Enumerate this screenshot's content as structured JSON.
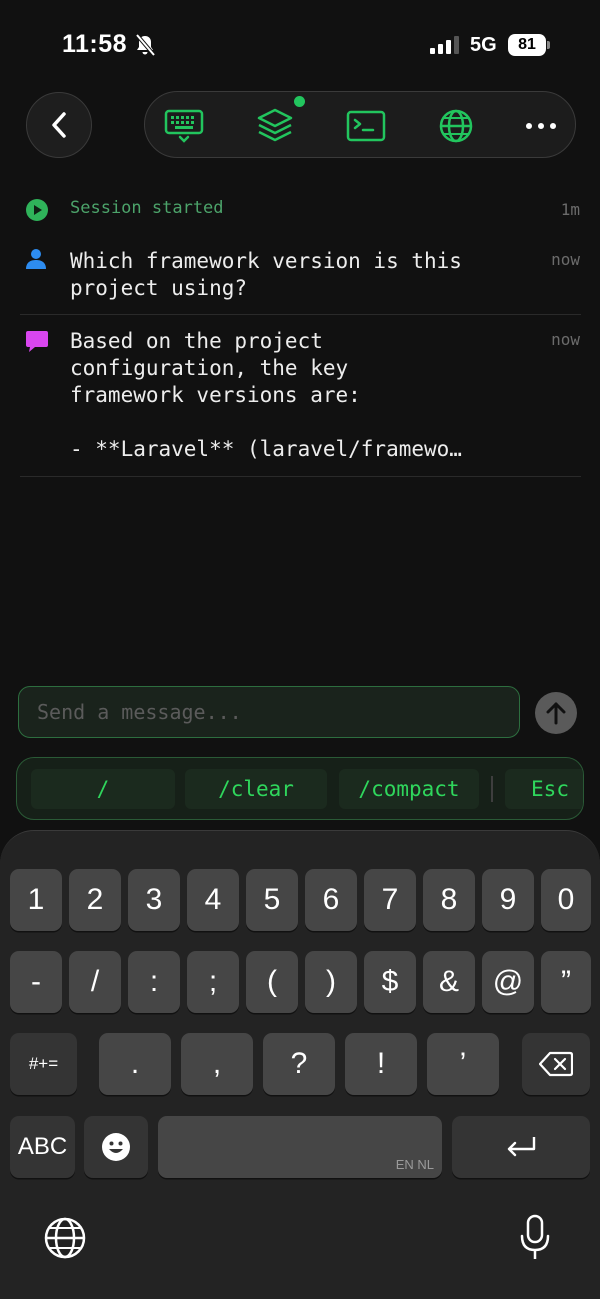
{
  "status_bar": {
    "time": "11:58",
    "network": "5G",
    "battery": "81"
  },
  "toolbar": {
    "icons": [
      "keyboard-icon",
      "layers-icon",
      "terminal-icon",
      "globe-icon",
      "more-icon"
    ],
    "accent": "#22c55e"
  },
  "session": {
    "text": "Session started",
    "time": "1m"
  },
  "messages": [
    {
      "role": "user",
      "icon": "user-icon",
      "text": "Which framework version is this\nproject using?",
      "time": "now"
    },
    {
      "role": "assistant",
      "icon": "chat-bubble-icon",
      "text": "Based on the project\nconfiguration, the key\nframework versions are:\n\n- **Laravel** (laravel/framewo…",
      "time": "now"
    }
  ],
  "composer": {
    "placeholder": "Send a message..."
  },
  "quick_commands": [
    "/",
    "/clear",
    "/compact",
    "Esc"
  ],
  "keyboard": {
    "row1": [
      "1",
      "2",
      "3",
      "4",
      "5",
      "6",
      "7",
      "8",
      "9",
      "0"
    ],
    "row2": [
      "-",
      "/",
      ":",
      ";",
      "(",
      ")",
      "$",
      "&",
      "@",
      "”"
    ],
    "row3_left": "#+=",
    "row3": [
      ".",
      ",",
      "?",
      "!",
      "’"
    ],
    "abc": "ABC",
    "language": "EN NL"
  }
}
